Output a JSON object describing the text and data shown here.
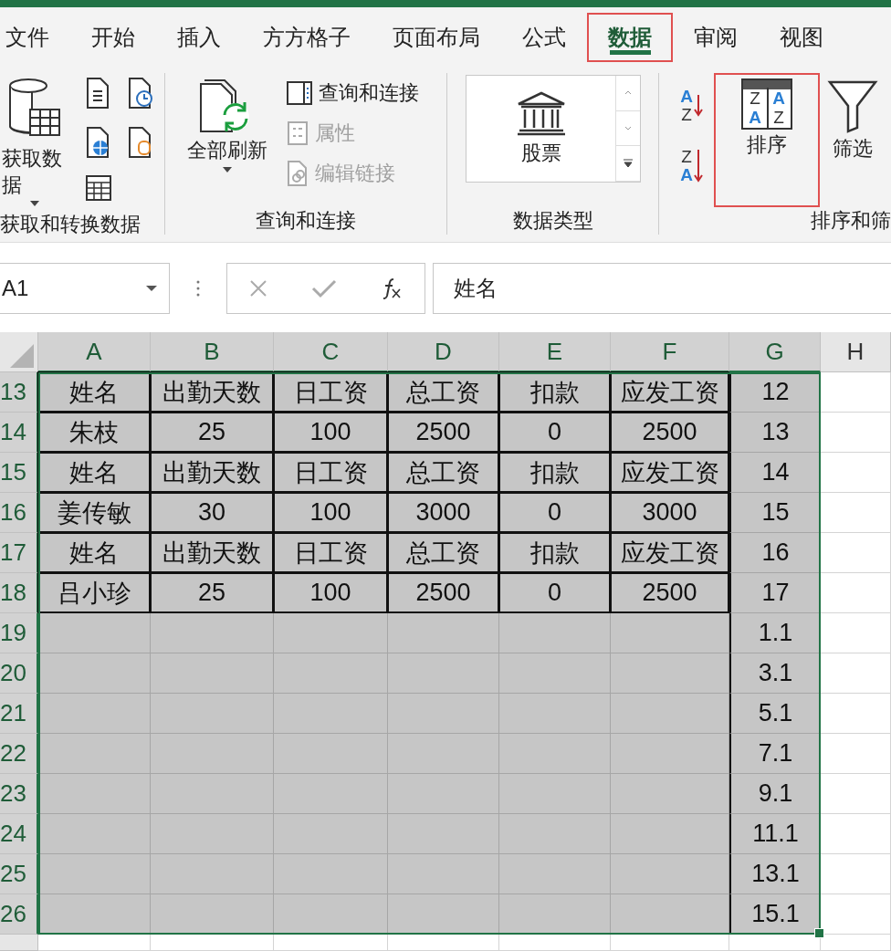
{
  "tabs": [
    {
      "label": "文件",
      "selected": false,
      "highlighted": false
    },
    {
      "label": "开始",
      "selected": false,
      "highlighted": false
    },
    {
      "label": "插入",
      "selected": false,
      "highlighted": false
    },
    {
      "label": "方方格子",
      "selected": false,
      "highlighted": false
    },
    {
      "label": "页面布局",
      "selected": false,
      "highlighted": false
    },
    {
      "label": "公式",
      "selected": false,
      "highlighted": false
    },
    {
      "label": "数据",
      "selected": true,
      "highlighted": true
    },
    {
      "label": "审阅",
      "selected": false,
      "highlighted": false
    },
    {
      "label": "视图",
      "selected": false,
      "highlighted": false
    }
  ],
  "ribbon": {
    "groups": [
      {
        "kind": "get-data",
        "label": "获取和转换数据",
        "items": [
          {
            "label": "获取数据",
            "disabled": false,
            "highlighted": false
          }
        ]
      },
      {
        "kind": "queries",
        "label": "查询和连接",
        "items": [
          {
            "label": "全部刷新",
            "disabled": false,
            "highlighted": false
          },
          {
            "label": "查询和连接",
            "disabled": false,
            "highlighted": false
          },
          {
            "label": "属性",
            "disabled": true,
            "highlighted": false
          },
          {
            "label": "编辑链接",
            "disabled": true,
            "highlighted": false
          }
        ]
      },
      {
        "kind": "data-types",
        "label": "数据类型",
        "items": [
          {
            "label": "股票",
            "disabled": false,
            "highlighted": false
          }
        ]
      },
      {
        "kind": "sort-filter",
        "label": "排序和筛",
        "quick_sort": [
          {
            "top": "A",
            "bottom": "Z"
          },
          {
            "top": "Z",
            "bottom": "A"
          }
        ],
        "sort_icon_letters": [
          "Z",
          "A",
          "A",
          "Z"
        ],
        "items": [
          {
            "label": "排序",
            "disabled": false,
            "highlighted": true
          },
          {
            "label": "筛选",
            "disabled": false,
            "highlighted": false
          }
        ]
      }
    ]
  },
  "formula_bar": {
    "name_box": "A1",
    "formula": "姓名"
  },
  "sheet": {
    "columns": [
      {
        "label": "A",
        "selected": true,
        "boxed": true,
        "rule_left": false
      },
      {
        "label": "B",
        "selected": true,
        "boxed": true,
        "rule_left": false
      },
      {
        "label": "C",
        "selected": true,
        "boxed": true,
        "rule_left": false
      },
      {
        "label": "D",
        "selected": true,
        "boxed": true,
        "rule_left": false
      },
      {
        "label": "E",
        "selected": true,
        "boxed": true,
        "rule_left": false
      },
      {
        "label": "F",
        "selected": true,
        "boxed": true,
        "rule_left": false
      },
      {
        "label": "G",
        "selected": true,
        "boxed": false,
        "rule_left": true
      },
      {
        "label": "H",
        "selected": false
      }
    ],
    "rows": [
      {
        "number": "13",
        "selected": true,
        "boxed": true,
        "cells": [
          "姓名",
          "出勤天数",
          "日工资",
          "总工资",
          "扣款",
          "应发工资",
          "12"
        ]
      },
      {
        "number": "14",
        "selected": true,
        "boxed": true,
        "cells": [
          "朱枝",
          "25",
          "100",
          "2500",
          "0",
          "2500",
          "13"
        ]
      },
      {
        "number": "15",
        "selected": true,
        "boxed": true,
        "cells": [
          "姓名",
          "出勤天数",
          "日工资",
          "总工资",
          "扣款",
          "应发工资",
          "14"
        ]
      },
      {
        "number": "16",
        "selected": true,
        "boxed": true,
        "cells": [
          "姜传敏",
          "30",
          "100",
          "3000",
          "0",
          "3000",
          "15"
        ]
      },
      {
        "number": "17",
        "selected": true,
        "boxed": true,
        "cells": [
          "姓名",
          "出勤天数",
          "日工资",
          "总工资",
          "扣款",
          "应发工资",
          "16"
        ]
      },
      {
        "number": "18",
        "selected": true,
        "boxed": true,
        "cells": [
          "吕小珍",
          "25",
          "100",
          "2500",
          "0",
          "2500",
          "17"
        ]
      },
      {
        "number": "19",
        "selected": true,
        "boxed": false,
        "cells": [
          "",
          "",
          "",
          "",
          "",
          "",
          "1.1"
        ]
      },
      {
        "number": "20",
        "selected": true,
        "boxed": false,
        "cells": [
          "",
          "",
          "",
          "",
          "",
          "",
          "3.1"
        ]
      },
      {
        "number": "21",
        "selected": true,
        "boxed": false,
        "cells": [
          "",
          "",
          "",
          "",
          "",
          "",
          "5.1"
        ]
      },
      {
        "number": "22",
        "selected": true,
        "boxed": false,
        "cells": [
          "",
          "",
          "",
          "",
          "",
          "",
          "7.1"
        ]
      },
      {
        "number": "23",
        "selected": true,
        "boxed": false,
        "cells": [
          "",
          "",
          "",
          "",
          "",
          "",
          "9.1"
        ]
      },
      {
        "number": "24",
        "selected": true,
        "boxed": false,
        "cells": [
          "",
          "",
          "",
          "",
          "",
          "",
          "11.1"
        ]
      },
      {
        "number": "25",
        "selected": true,
        "boxed": false,
        "cells": [
          "",
          "",
          "",
          "",
          "",
          "",
          "13.1"
        ]
      },
      {
        "number": "26",
        "selected": true,
        "boxed": false,
        "cells": [
          "",
          "",
          "",
          "",
          "",
          "",
          "15.1"
        ]
      }
    ]
  }
}
